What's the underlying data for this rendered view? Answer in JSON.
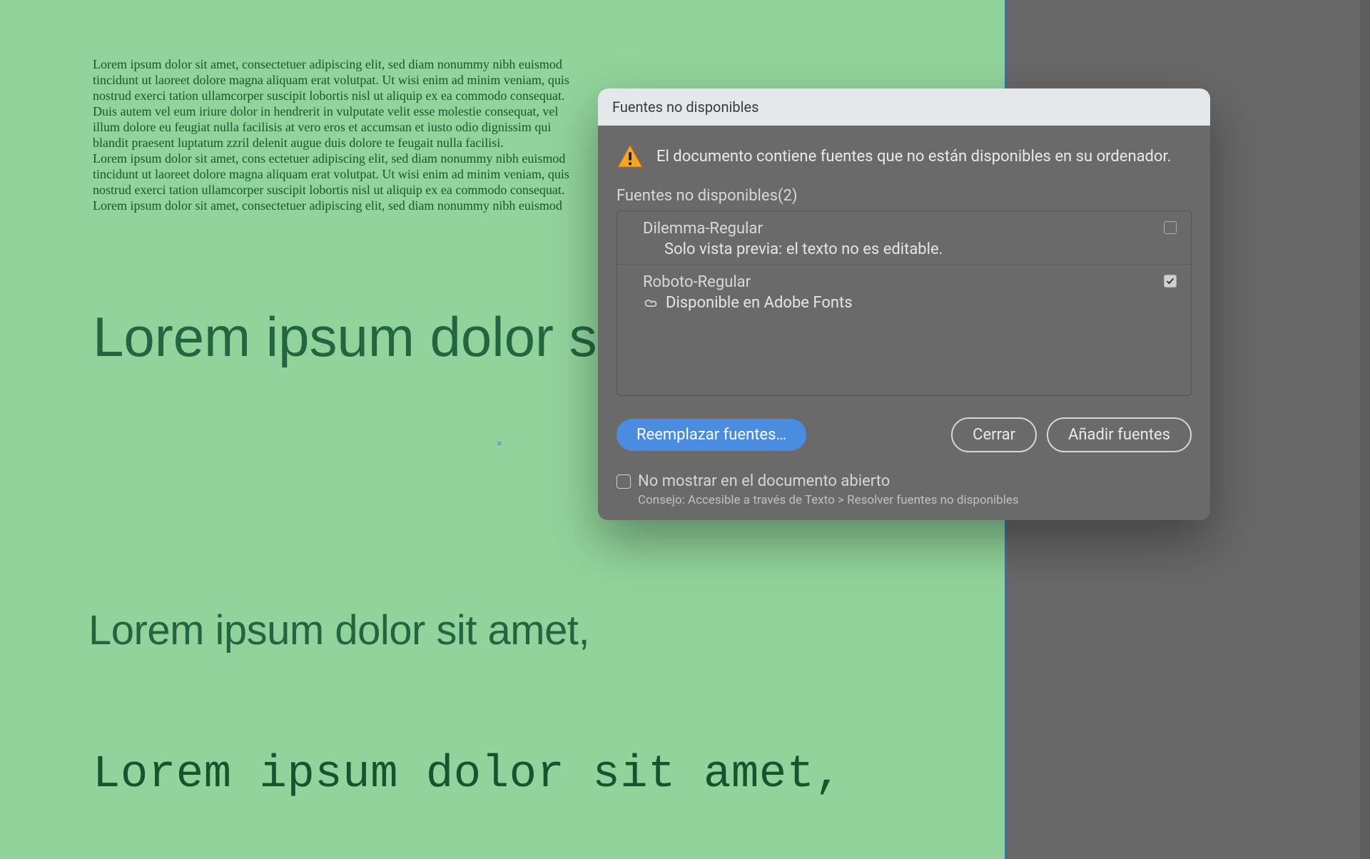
{
  "doc": {
    "paragraph": "Lorem ipsum dolor sit amet, consectetuer adipiscing elit, sed diam nonummy nibh euismod tincidunt ut laoreet dolore magna aliquam erat volutpat. Ut wisi enim ad minim veniam, quis nostrud exerci tation ullamcorper suscipit lobortis nisl ut aliquip ex ea commodo consequat. Duis autem vel eum iriure dolor in hendrerit in vulputate velit esse molestie consequat, vel illum dolore eu feugiat nulla facilisis at vero eros et accumsan et iusto odio dignissim qui blandit praesent luptatum zzril delenit augue duis dolore te feugait nulla facilisi.\nLorem ipsum dolor sit amet, cons ectetuer adipiscing elit, sed diam nonummy nibh euismod tincidunt ut laoreet dolore magna aliquam erat volutpat. Ut wisi enim ad minim veniam, quis nostrud exerci tation ullamcorper suscipit lobortis nisl ut aliquip ex ea commodo consequat.\nLorem ipsum dolor sit amet, consectetuer adipiscing elit, sed diam nonummy nibh euismod",
    "headline1": "Lorem ipsum dolor sit amet,",
    "headline2": "Lorem ipsum dolor sit amet,",
    "headline3": "Lorem ipsum dolor sit amet,",
    "marker": "×"
  },
  "dialog": {
    "title": "Fuentes no disponibles",
    "warning": "El documento contiene fuentes que no están disponibles en su ordenador.",
    "list_label": "Fuentes no disponibles(2)",
    "fonts": [
      {
        "name": "Dilemma-Regular",
        "sub": "Solo vista previa: el texto no es editable.",
        "has_icon": false,
        "checked": false
      },
      {
        "name": "Roboto-Regular",
        "sub": "Disponible en Adobe Fonts",
        "has_icon": true,
        "checked": true
      }
    ],
    "replace_btn": "Reemplazar fuentes…",
    "close_btn": "Cerrar",
    "add_btn": "Añadir fuentes",
    "dont_show": "No mostrar en el documento abierto",
    "tip": "Consejo: Accesible a través de Texto > Resolver fuentes no disponibles"
  }
}
